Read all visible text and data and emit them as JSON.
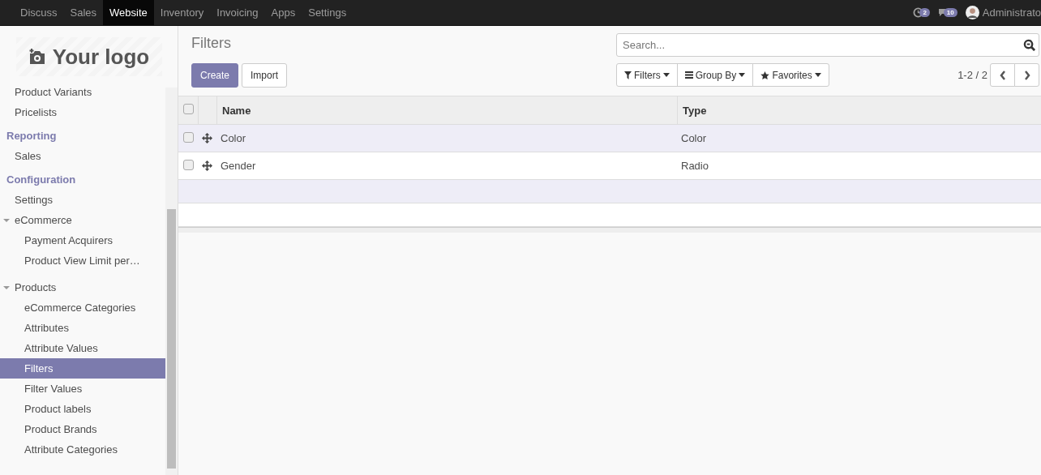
{
  "navbar": {
    "apps": [
      {
        "label": "Discuss",
        "selected": false
      },
      {
        "label": "Sales",
        "selected": false
      },
      {
        "label": "Website",
        "selected": true
      },
      {
        "label": "Inventory",
        "selected": false
      },
      {
        "label": "Invoicing",
        "selected": false
      },
      {
        "label": "Apps",
        "selected": false
      },
      {
        "label": "Settings",
        "selected": false
      }
    ],
    "activity_count": "2",
    "message_count": "10",
    "user": "Administrato"
  },
  "sidebar": {
    "logo": "Your logo",
    "menu": [
      {
        "kind": "item",
        "label": "Product Variants",
        "selected": false
      },
      {
        "kind": "item",
        "label": "Pricelists",
        "selected": false
      },
      {
        "kind": "header",
        "label": "Reporting"
      },
      {
        "kind": "item",
        "label": "Sales",
        "selected": false
      },
      {
        "kind": "header",
        "label": "Configuration"
      },
      {
        "kind": "item",
        "label": "Settings",
        "selected": false
      },
      {
        "kind": "folder",
        "label": "eCommerce",
        "expanded": true,
        "children": [
          {
            "label": "Payment Acquirers",
            "selected": false
          },
          {
            "label": "Product View Limit per…",
            "selected": false
          }
        ]
      },
      {
        "kind": "folder",
        "label": "Products",
        "expanded": true,
        "children": [
          {
            "label": "eCommerce Categories",
            "selected": false
          },
          {
            "label": "Attributes",
            "selected": false
          },
          {
            "label": "Attribute Values",
            "selected": false
          },
          {
            "label": "Filters",
            "selected": true
          },
          {
            "label": "Filter Values",
            "selected": false
          },
          {
            "label": "Product labels",
            "selected": false
          },
          {
            "label": "Product Brands",
            "selected": false
          },
          {
            "label": "Attribute Categories",
            "selected": false
          }
        ]
      }
    ]
  },
  "page": {
    "title": "Filters",
    "buttons": [
      {
        "label": "Create",
        "kind": "primary"
      },
      {
        "label": "Import",
        "kind": "secondary"
      }
    ],
    "search": {
      "placeholder": "Search..."
    },
    "search_buttons": [
      {
        "label": "Filters",
        "kind": "filter"
      },
      {
        "label": "Group By",
        "kind": "group"
      },
      {
        "label": "Favorites",
        "kind": "star"
      }
    ],
    "pager": "1-2 / 2"
  },
  "table": {
    "select_all_checked": false,
    "columns": [
      "Name",
      "Type"
    ],
    "rows": [
      {
        "name": "Color",
        "type": "Color",
        "checked": false
      },
      {
        "name": "Gender",
        "type": "Radio",
        "checked": false
      }
    ]
  }
}
